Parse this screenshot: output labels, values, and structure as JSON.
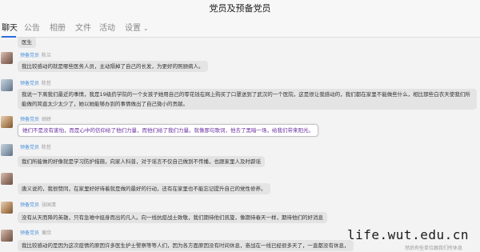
{
  "window": {
    "title": "党员及预备党员"
  },
  "tabs": [
    {
      "label": "聊天",
      "active": true
    },
    {
      "label": "公告"
    },
    {
      "label": "相册"
    },
    {
      "label": "文件"
    },
    {
      "label": "活动"
    },
    {
      "label": "设置"
    }
  ],
  "messages": [
    {
      "text": "医生"
    },
    {
      "role": "预备党员",
      "name": "陈兰",
      "text": "我比较感动的就是哪些医务人员，主动隔掉了自己的长发，为更好的照顾病人。"
    },
    {
      "role": "预备党员",
      "name": "陈哲",
      "text": "我说一下离我们最近的事情，我是19级药学院的一个女孩子她用自己的零花钱在网上购买了口罩送到了武汉的一个医院，这是很让我感动的，我们都在家里不能做些什么，相比那些白衣天使我们所能做的简直太少太少了，她以她能够办到的事情做出了自己微小的贡献。"
    },
    {
      "role": "预备党员",
      "name": "胡娇",
      "text": "她们不是没有害怕，而是心中的信仰给了他们力量，而他们给了我们力量。就像那句歌词，他去了黑暗一场，给我们带来阳光。"
    },
    {
      "role": "预备党员",
      "name": "陈哲",
      "text": "我们所能做的好像就是学习防护措施，向家人科普，对于谣言不仅自己做到不传播，也跟家里人及时辟谣"
    },
    {
      "text": "唐义说的，我很赞同，在家里好好待着就是做的最好的行动，还有在家里也不能忘记提升自己的党性修养。"
    },
    {
      "role": "预备党员",
      "name": "张国清",
      "text": "没有从天而降的英雄，只有急难中挺身而出的凡人。向一线抗疫战士致敬，我们期待他们凯旋，像期待春天一样，期待他们的好消息"
    },
    {
      "role": "预备党员",
      "name": "黄欣",
      "text": "我比较感动的是因为这次疫情的原因许多医生护士警察等等人们，因为各方面原因没有时间休息，奋战在一线已经很多天了，一直都没有休息，"
    }
  ],
  "watermark": {
    "text": "life.wut.edu.cn",
    "sub": "然后有些单位跟我们所休息"
  }
}
